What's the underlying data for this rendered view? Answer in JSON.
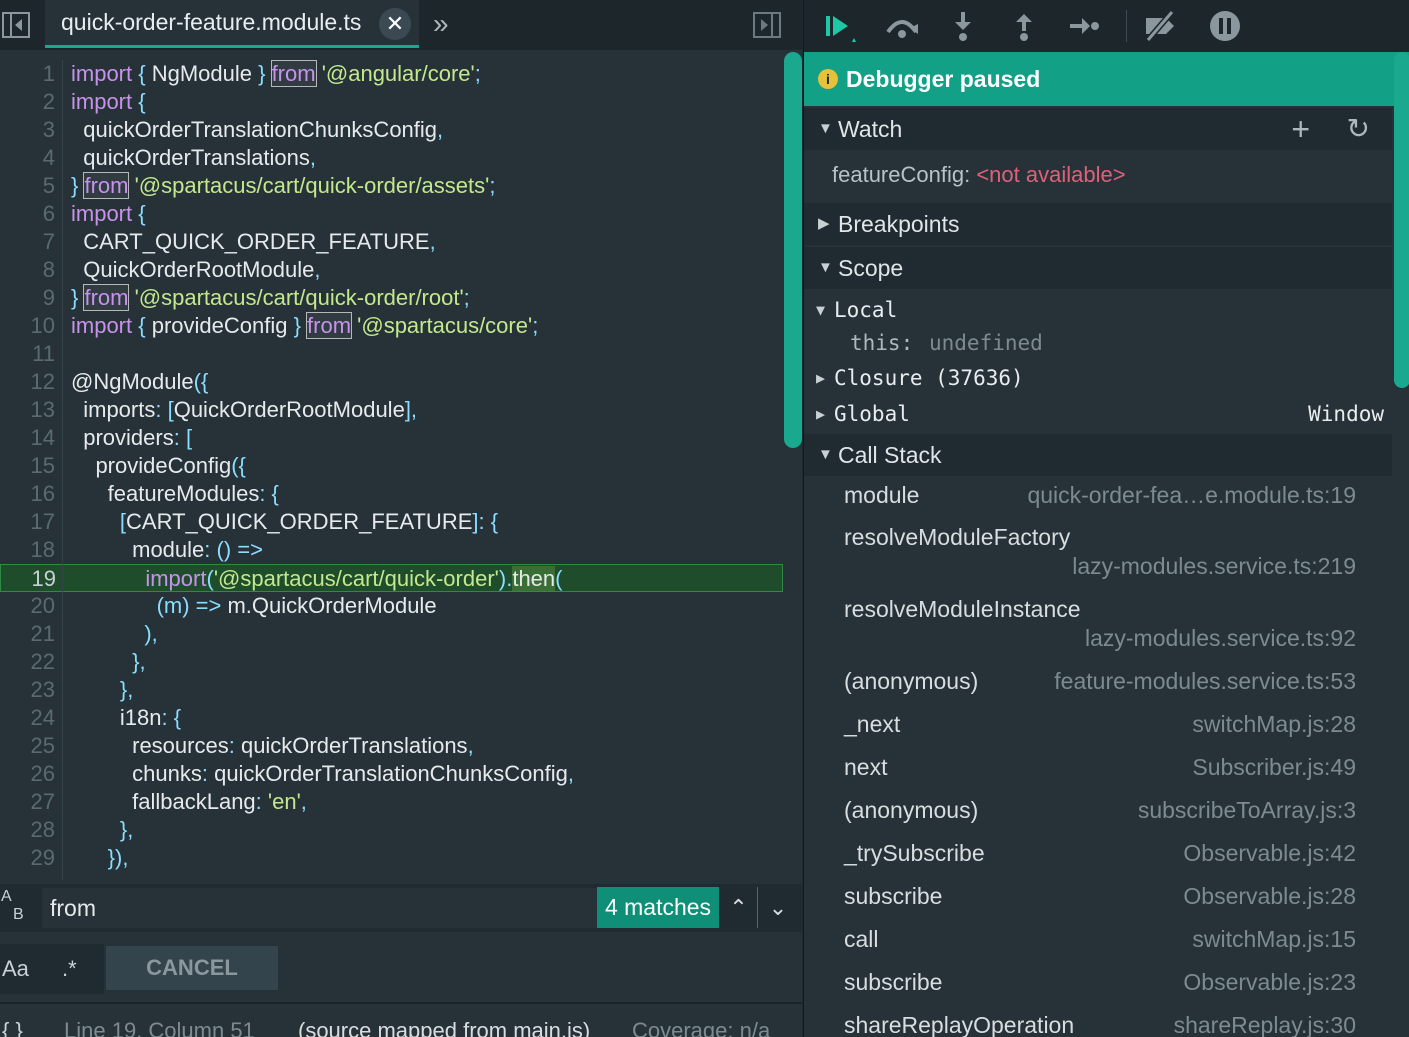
{
  "editor": {
    "tab_title": "quick-order-feature.module.ts",
    "tab_close": "✕",
    "more_tabs": "»",
    "lines": [
      {
        "n": "1",
        "parts": [
          [
            "kw",
            "import"
          ],
          [
            "pun",
            " { "
          ],
          [
            "t",
            "NgModule"
          ],
          [
            "pun",
            " } "
          ],
          [
            "kwhl",
            "from"
          ],
          [
            "t",
            " "
          ],
          [
            "str",
            "'@angular/core'"
          ],
          [
            "pun",
            ";"
          ]
        ]
      },
      {
        "n": "2",
        "parts": [
          [
            "kw",
            "import"
          ],
          [
            "pun",
            " {"
          ]
        ]
      },
      {
        "n": "3",
        "parts": [
          [
            "t",
            "  quickOrderTranslationChunksConfig"
          ],
          [
            "pun",
            ","
          ]
        ]
      },
      {
        "n": "4",
        "parts": [
          [
            "t",
            "  quickOrderTranslations"
          ],
          [
            "pun",
            ","
          ]
        ]
      },
      {
        "n": "5",
        "parts": [
          [
            "pun",
            "} "
          ],
          [
            "kwhl",
            "from"
          ],
          [
            "t",
            " "
          ],
          [
            "str",
            "'@spartacus/cart/quick-order/assets'"
          ],
          [
            "pun",
            ";"
          ]
        ]
      },
      {
        "n": "6",
        "parts": [
          [
            "kw",
            "import"
          ],
          [
            "pun",
            " {"
          ]
        ]
      },
      {
        "n": "7",
        "parts": [
          [
            "t",
            "  CART_QUICK_ORDER_FEATURE"
          ],
          [
            "pun",
            ","
          ]
        ]
      },
      {
        "n": "8",
        "parts": [
          [
            "t",
            "  QuickOrderRootModule"
          ],
          [
            "pun",
            ","
          ]
        ]
      },
      {
        "n": "9",
        "parts": [
          [
            "pun",
            "} "
          ],
          [
            "kwhl",
            "from"
          ],
          [
            "t",
            " "
          ],
          [
            "str",
            "'@spartacus/cart/quick-order/root'"
          ],
          [
            "pun",
            ";"
          ]
        ]
      },
      {
        "n": "10",
        "parts": [
          [
            "kw",
            "import"
          ],
          [
            "pun",
            " { "
          ],
          [
            "t",
            "provideConfig"
          ],
          [
            "pun",
            " } "
          ],
          [
            "kwhl",
            "from"
          ],
          [
            "t",
            " "
          ],
          [
            "str",
            "'@spartacus/core'"
          ],
          [
            "pun",
            ";"
          ]
        ]
      },
      {
        "n": "11",
        "parts": []
      },
      {
        "n": "12",
        "parts": [
          [
            "t",
            "@NgModule"
          ],
          [
            "pun",
            "({"
          ]
        ]
      },
      {
        "n": "13",
        "parts": [
          [
            "t",
            "  imports"
          ],
          [
            "pun",
            ": ["
          ],
          [
            "t",
            "QuickOrderRootModule"
          ],
          [
            "pun",
            "],"
          ]
        ]
      },
      {
        "n": "14",
        "parts": [
          [
            "t",
            "  providers"
          ],
          [
            "pun",
            ": ["
          ]
        ]
      },
      {
        "n": "15",
        "parts": [
          [
            "t",
            "    provideConfig"
          ],
          [
            "pun",
            "({"
          ]
        ]
      },
      {
        "n": "16",
        "parts": [
          [
            "t",
            "      featureModules"
          ],
          [
            "pun",
            ": {"
          ]
        ]
      },
      {
        "n": "17",
        "parts": [
          [
            "pun",
            "        ["
          ],
          [
            "t",
            "CART_QUICK_ORDER_FEATURE"
          ],
          [
            "pun",
            "]: {"
          ]
        ]
      },
      {
        "n": "18",
        "parts": [
          [
            "t",
            "          module"
          ],
          [
            "pun",
            ": () =>"
          ]
        ]
      },
      {
        "n": "19",
        "current": true,
        "parts": [
          [
            "kw",
            "            import"
          ],
          [
            "pun",
            "("
          ],
          [
            "str",
            "'@spartacus/cart/quick-order'"
          ],
          [
            "pun",
            ")."
          ],
          [
            "cur",
            "then"
          ],
          [
            "pun",
            "("
          ]
        ]
      },
      {
        "n": "20",
        "parts": [
          [
            "pun",
            "              (m) => "
          ],
          [
            "t",
            "m.QuickOrderModule"
          ]
        ]
      },
      {
        "n": "21",
        "parts": [
          [
            "pun",
            "            ),"
          ]
        ]
      },
      {
        "n": "22",
        "parts": [
          [
            "pun",
            "          },"
          ]
        ]
      },
      {
        "n": "23",
        "parts": [
          [
            "pun",
            "        },"
          ]
        ]
      },
      {
        "n": "24",
        "parts": [
          [
            "t",
            "        i18n"
          ],
          [
            "pun",
            ": {"
          ]
        ]
      },
      {
        "n": "25",
        "parts": [
          [
            "t",
            "          resources"
          ],
          [
            "pun",
            ": "
          ],
          [
            "t",
            "quickOrderTranslations"
          ],
          [
            "pun",
            ","
          ]
        ]
      },
      {
        "n": "26",
        "parts": [
          [
            "t",
            "          chunks"
          ],
          [
            "pun",
            ": "
          ],
          [
            "t",
            "quickOrderTranslationChunksConfig"
          ],
          [
            "pun",
            ","
          ]
        ]
      },
      {
        "n": "27",
        "parts": [
          [
            "t",
            "          fallbackLang"
          ],
          [
            "pun",
            ": "
          ],
          [
            "str",
            "'en'"
          ],
          [
            "pun",
            ","
          ]
        ]
      },
      {
        "n": "28",
        "parts": [
          [
            "pun",
            "        },"
          ]
        ]
      },
      {
        "n": "29",
        "parts": [
          [
            "pun",
            "      }),"
          ]
        ]
      }
    ]
  },
  "search": {
    "case_icon_top": "A",
    "case_icon_bottom": "B",
    "query": "from",
    "matches": "4 matches",
    "prev": "⌃",
    "next": "⌄",
    "case_toggle": "Aa",
    "regex_toggle": ".*",
    "cancel": "CANCEL"
  },
  "status": {
    "braces": "{ }",
    "position": "Line 19, Column 51",
    "source_map": "(source mapped from main.js)",
    "coverage": "Coverage: n/a"
  },
  "debugger": {
    "paused_icon": "i",
    "paused_text": "Debugger paused",
    "watch": {
      "title": "Watch",
      "add": "+",
      "refresh": "↻",
      "expr_name": "featureConfig",
      "expr_sep": ": ",
      "expr_value": "<not available>"
    },
    "breakpoints_title": "Breakpoints",
    "scope_title": "Scope",
    "scope": {
      "local": "Local",
      "this_key": "this:",
      "this_val": "undefined",
      "closure": "Closure (37636)",
      "global": "Global",
      "global_val": "Window"
    },
    "callstack_title": "Call Stack",
    "frames": [
      {
        "name": "module",
        "loc": "quick-order-fea…e.module.ts:19"
      },
      {
        "name": "resolveModuleFactory",
        "loc": "lazy-modules.service.ts:219"
      },
      {
        "name": "resolveModuleInstance",
        "loc": "lazy-modules.service.ts:92"
      },
      {
        "name": "(anonymous)",
        "loc": "feature-modules.service.ts:53"
      },
      {
        "name": "_next",
        "loc": "switchMap.js:28"
      },
      {
        "name": "next",
        "loc": "Subscriber.js:49"
      },
      {
        "name": "(anonymous)",
        "loc": "subscribeToArray.js:3"
      },
      {
        "name": "_trySubscribe",
        "loc": "Observable.js:42"
      },
      {
        "name": "subscribe",
        "loc": "Observable.js:28"
      },
      {
        "name": "call",
        "loc": "switchMap.js:15"
      },
      {
        "name": "subscribe",
        "loc": "Observable.js:23"
      },
      {
        "name": "shareReplayOperation",
        "loc": "shareReplay.js:30"
      }
    ]
  },
  "colors": {
    "accent": "#1aa88f",
    "keyword": "#c792ea",
    "string": "#c3e88d",
    "punctuation": "#89ddff",
    "current_line": "#1f4d2c",
    "not_available": "#e0607a"
  }
}
